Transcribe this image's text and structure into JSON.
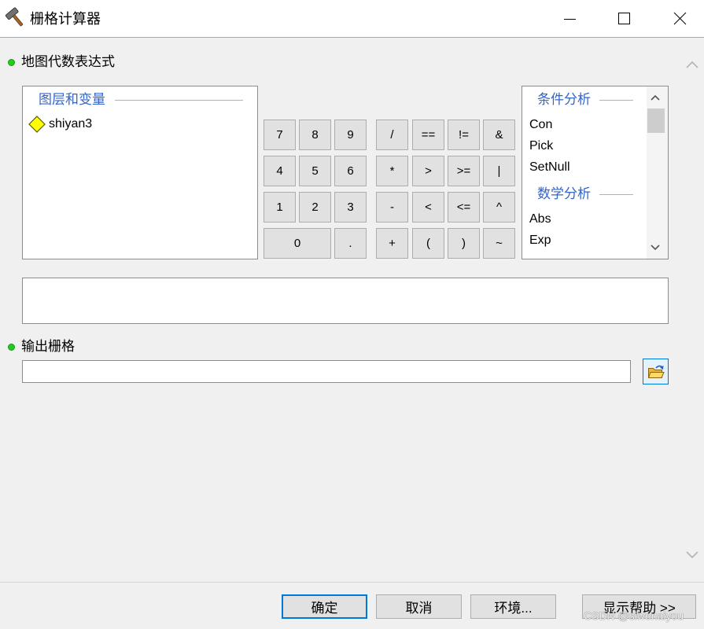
{
  "window": {
    "title": "栅格计算器",
    "icon": "hammer-icon",
    "controls": [
      "minimize-icon",
      "maximize-icon",
      "close-icon"
    ]
  },
  "expression": {
    "label": "地图代数表达式",
    "layers": {
      "header": "图层和变量",
      "items": [
        {
          "name": "shiyan3",
          "icon": "raster-layer-diamond-icon"
        }
      ]
    },
    "keypad": {
      "digits": [
        "7",
        "8",
        "9",
        "4",
        "5",
        "6",
        "1",
        "2",
        "3",
        "0",
        "."
      ],
      "operators": [
        "/",
        "==",
        "!=",
        "&",
        "*",
        ">",
        ">=",
        "|",
        "-",
        "<",
        "<=",
        "^",
        "+",
        "(",
        ")",
        "~"
      ]
    },
    "tools": {
      "groups": [
        {
          "header": "条件分析",
          "items": [
            "Con",
            "Pick",
            "SetNull"
          ]
        },
        {
          "header": "数学分析",
          "items": [
            "Abs",
            "Exp"
          ]
        }
      ]
    },
    "value": ""
  },
  "output": {
    "label": "输出栅格",
    "value": "",
    "browse_icon": "open-folder-icon"
  },
  "footer": {
    "ok_label": "确定",
    "cancel_label": "取消",
    "environments_label": "环境...",
    "show_help_label": "显示帮助 >>"
  },
  "watermark": "CSDN @siwenaiyou",
  "colors": {
    "accent": "#0078d7",
    "group_header": "#3465c8",
    "required_dot": "#22cc22",
    "layer_diamond": "#ffff00"
  }
}
